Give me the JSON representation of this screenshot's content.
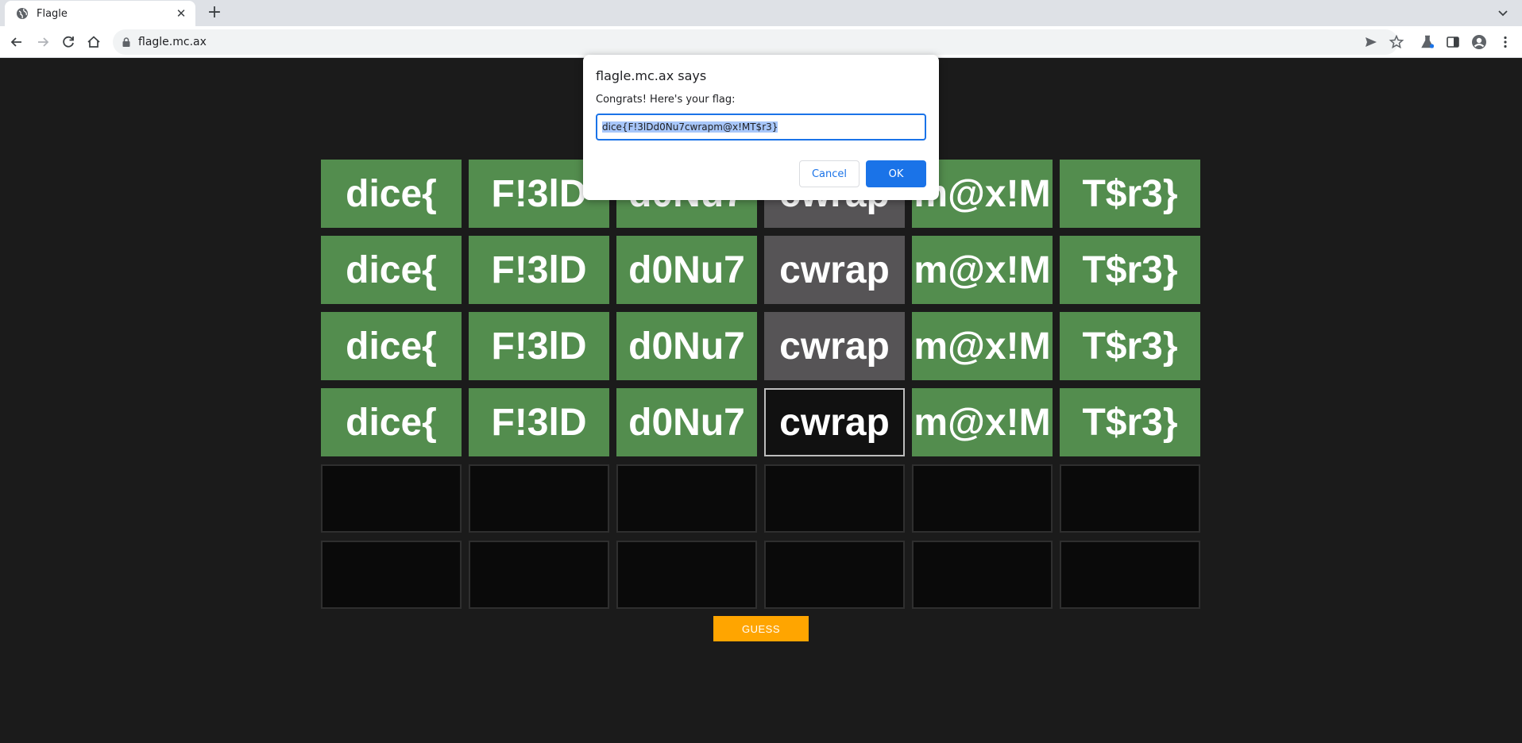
{
  "browser": {
    "tab_title": "Flagle",
    "tab_close": "✕",
    "new_tab": "+",
    "url": "flagle.mc.ax"
  },
  "board": {
    "rows": [
      [
        {
          "text": "dice{",
          "state": "green"
        },
        {
          "text": "F!3lD",
          "state": "green"
        },
        {
          "text": "d0Nu7",
          "state": "green"
        },
        {
          "text": "cwrap",
          "state": "gray"
        },
        {
          "text": "m@x!M",
          "state": "green"
        },
        {
          "text": "T$r3}",
          "state": "green"
        }
      ],
      [
        {
          "text": "dice{",
          "state": "green"
        },
        {
          "text": "F!3lD",
          "state": "green"
        },
        {
          "text": "d0Nu7",
          "state": "green"
        },
        {
          "text": "cwrap",
          "state": "gray"
        },
        {
          "text": "m@x!M",
          "state": "green"
        },
        {
          "text": "T$r3}",
          "state": "green"
        }
      ],
      [
        {
          "text": "dice{",
          "state": "green"
        },
        {
          "text": "F!3lD",
          "state": "green"
        },
        {
          "text": "d0Nu7",
          "state": "green"
        },
        {
          "text": "cwrap",
          "state": "gray"
        },
        {
          "text": "m@x!M",
          "state": "green"
        },
        {
          "text": "T$r3}",
          "state": "green"
        }
      ],
      [
        {
          "text": "dice{",
          "state": "green"
        },
        {
          "text": "F!3lD",
          "state": "green"
        },
        {
          "text": "d0Nu7",
          "state": "green"
        },
        {
          "text": "cwrap",
          "state": "active"
        },
        {
          "text": "m@x!M",
          "state": "green"
        },
        {
          "text": "T$r3}",
          "state": "green"
        }
      ],
      [
        {
          "text": "",
          "state": "empty"
        },
        {
          "text": "",
          "state": "empty"
        },
        {
          "text": "",
          "state": "empty"
        },
        {
          "text": "",
          "state": "empty"
        },
        {
          "text": "",
          "state": "empty"
        },
        {
          "text": "",
          "state": "empty"
        }
      ],
      [
        {
          "text": "",
          "state": "empty"
        },
        {
          "text": "",
          "state": "empty"
        },
        {
          "text": "",
          "state": "empty"
        },
        {
          "text": "",
          "state": "empty"
        },
        {
          "text": "",
          "state": "empty"
        },
        {
          "text": "",
          "state": "empty"
        }
      ]
    ],
    "guess_label": "GUESS"
  },
  "dialog": {
    "title": "flagle.mc.ax says",
    "message": "Congrats! Here's your flag:",
    "value": "dice{F!3lDd0Nu7cwrapm@x!MT$r3}",
    "cancel_label": "Cancel",
    "ok_label": "OK"
  },
  "colors": {
    "green": "#538d4e",
    "gray": "#565456",
    "guess": "#ffa500",
    "accent": "#1a73e8"
  }
}
